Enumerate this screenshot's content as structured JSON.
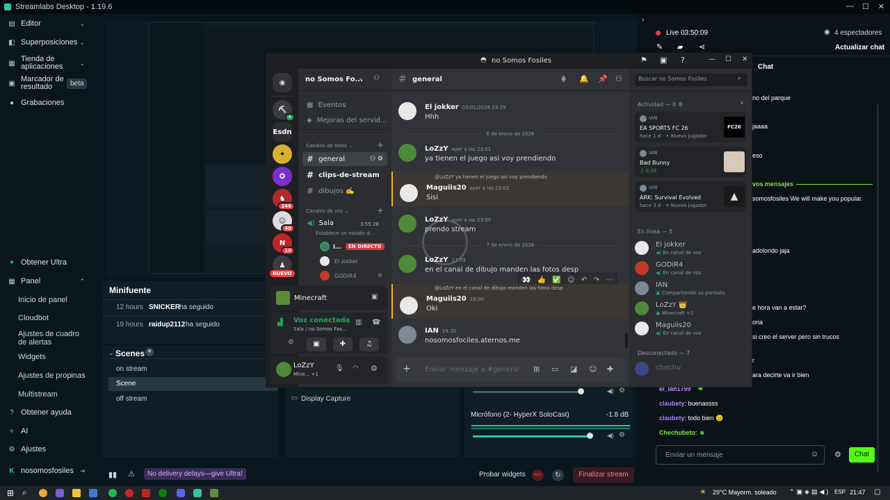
{
  "window": {
    "title": "Streamlabs Desktop - 1.19.6"
  },
  "sidebar": {
    "items": [
      {
        "label": "Editor",
        "icon": "editor-icon"
      },
      {
        "label": "Superposiciones",
        "icon": "overlay-icon"
      },
      {
        "label": "Tienda de aplicaciones",
        "icon": "store-icon"
      },
      {
        "label": "Marcador de resultado",
        "icon": "scoreboard-icon",
        "badge": "beta"
      },
      {
        "label": "Grabaciones",
        "icon": "recordings-icon"
      }
    ],
    "bottom": {
      "ultra": "Obtener Ultra",
      "panel": "Panel",
      "panel_items": [
        "Inicio de panel",
        "Cloudbot",
        "Ajustes de cuadro de alertas",
        "Widgets",
        "Ajustes de propinas",
        "Multistream"
      ],
      "help": "Obtener ayuda",
      "ai": "AI",
      "settings": "Ajustes",
      "user": "nosomosfosiles"
    }
  },
  "minifuente": {
    "title": "Minifuente",
    "rows": [
      {
        "time": "12 hours",
        "user": "SNICKER",
        "action": "ha seguido"
      },
      {
        "time": "19 hours",
        "user": "raidup2112",
        "action": "ha seguido"
      }
    ]
  },
  "scenes": {
    "title": "Scenes",
    "items": [
      "on stream",
      "Scene",
      "off stream"
    ]
  },
  "sources": {
    "item": "Display Capture"
  },
  "mixer": {
    "mic_label": "Micrófono (2- HyperX SoloCast)",
    "mic_db": "-1.8 dB"
  },
  "footer": {
    "ultra_text": "No delivery delays—give Ultra!",
    "test_widgets": "Probar widgets",
    "rec": "REC",
    "end_stream": "Finalizar stream"
  },
  "right": {
    "live": "Live 03:50:09",
    "viewers": "4 espectadores",
    "refresh": "Actualizar chat",
    "chat_title": "Chat",
    "lines": [
      "no del parque",
      "jaaaa",
      "eso",
      "vos mensajes",
      "somosfosiles We will make you popular.",
      "adolorido jaja",
      "e hora van a estar?",
      "oria",
      "si creo el server pero sin trucos",
      "r",
      "ara decirte va ir bien"
    ],
    "messages": [
      {
        "user": "el_ian1799",
        "text": ""
      },
      {
        "user": "claubety",
        "text": "buenassss"
      },
      {
        "user": "claubety",
        "text": "todo bien 😊"
      },
      {
        "user": "Chechubeto",
        "text": ""
      }
    ],
    "input_placeholder": "Enviar un mensaje",
    "chat_button": "Chat"
  },
  "discord": {
    "title": "no Somos Fosiles",
    "server": "no Somos Fo...",
    "guild_labels": [
      "Esdn"
    ],
    "guild_badges": [
      "246",
      "40",
      "10",
      "NUEVO"
    ],
    "top": [
      "Eventos",
      "Mejoras del servid..."
    ],
    "text_cat": "Canales de texto",
    "text_channels": [
      "general",
      "clips-de-stream",
      "dibujos ✍️"
    ],
    "voice_cat": "Canales de voz",
    "voice": {
      "name": "Sala",
      "time": "3:55:28",
      "status": "Establece un estado d...",
      "users": [
        {
          "name": "I...",
          "live": "EN DIRECTO"
        },
        {
          "name": "El jokker"
        },
        {
          "name": "GODiR4"
        }
      ]
    },
    "activity_game": "Minecraft",
    "voice_connected": "Voz conectada",
    "voice_where": "Sala / no Somos Fos...",
    "user": {
      "name": "LoZzY",
      "status": "Mine... +1"
    },
    "channel": "general",
    "search_placeholder": "Buscar no Somos Fosiles",
    "days": [
      "6 de enero de 2026",
      "7 de enero de 2026"
    ],
    "messages": [
      {
        "author": "El jokker",
        "time": "05/01/2026 23:25",
        "text": "Hhh"
      },
      {
        "author": "LoZzY",
        "time": "ayer a las 23:01",
        "text": "ya tienen el juego asi voy prendiendo"
      },
      {
        "reply": "@LoZzY ya tienen el juego asi voy prendiendo",
        "author": "Maguiis20",
        "time": "ayer a las 23:03",
        "text": "Sisi"
      },
      {
        "author": "LoZzY",
        "time": "ayer a las 23:05",
        "text": "prendo stream"
      },
      {
        "author": "LoZzY",
        "time": "17:59",
        "text": "en el canal de dibujo manden las fotos desp"
      },
      {
        "reply": "@LoZzY en el canal de dibujo manden las fotos desp",
        "author": "Maguiis20",
        "time": "18:00",
        "text": "Oki"
      },
      {
        "author": "IAN",
        "time": "19:35",
        "text": "nosomosfociles.aternos.me"
      }
    ],
    "input_placeholder": "Enviar mensaje a #general",
    "activity_title": "Actividad — 8",
    "activities": [
      {
        "user": "IAN",
        "game": "EA SPORTS FC 26",
        "meta": "hace 1 d",
        "tag": "Nuevo jugador",
        "thumb": "FC26"
      },
      {
        "user": "IAN",
        "game": "Bad Bunny",
        "meta": "0:39",
        "tag": "",
        "thumb": ""
      },
      {
        "user": "IAN",
        "game": "ARK: Survival Evolved",
        "meta": "hace 3 d",
        "tag": "Nuevo jugador",
        "thumb": ""
      }
    ],
    "online_title": "En línea — 5",
    "online": [
      {
        "name": "El jokker",
        "status": "En canal de voz"
      },
      {
        "name": "GODiR4",
        "status": "En canal de voz"
      },
      {
        "name": "IAN",
        "status": "Compartiendo su pantalla"
      },
      {
        "name": "LoZzY 👑",
        "status": "Minecraft +1"
      },
      {
        "name": "Maguiis20",
        "status": "En canal de voz"
      }
    ],
    "offline_title": "Desconectado — 7",
    "offline": [
      "chechu"
    ]
  },
  "taskbar": {
    "weather": "29°C  Mayorm. soleado",
    "lang": "ESP",
    "time": "21:47"
  }
}
